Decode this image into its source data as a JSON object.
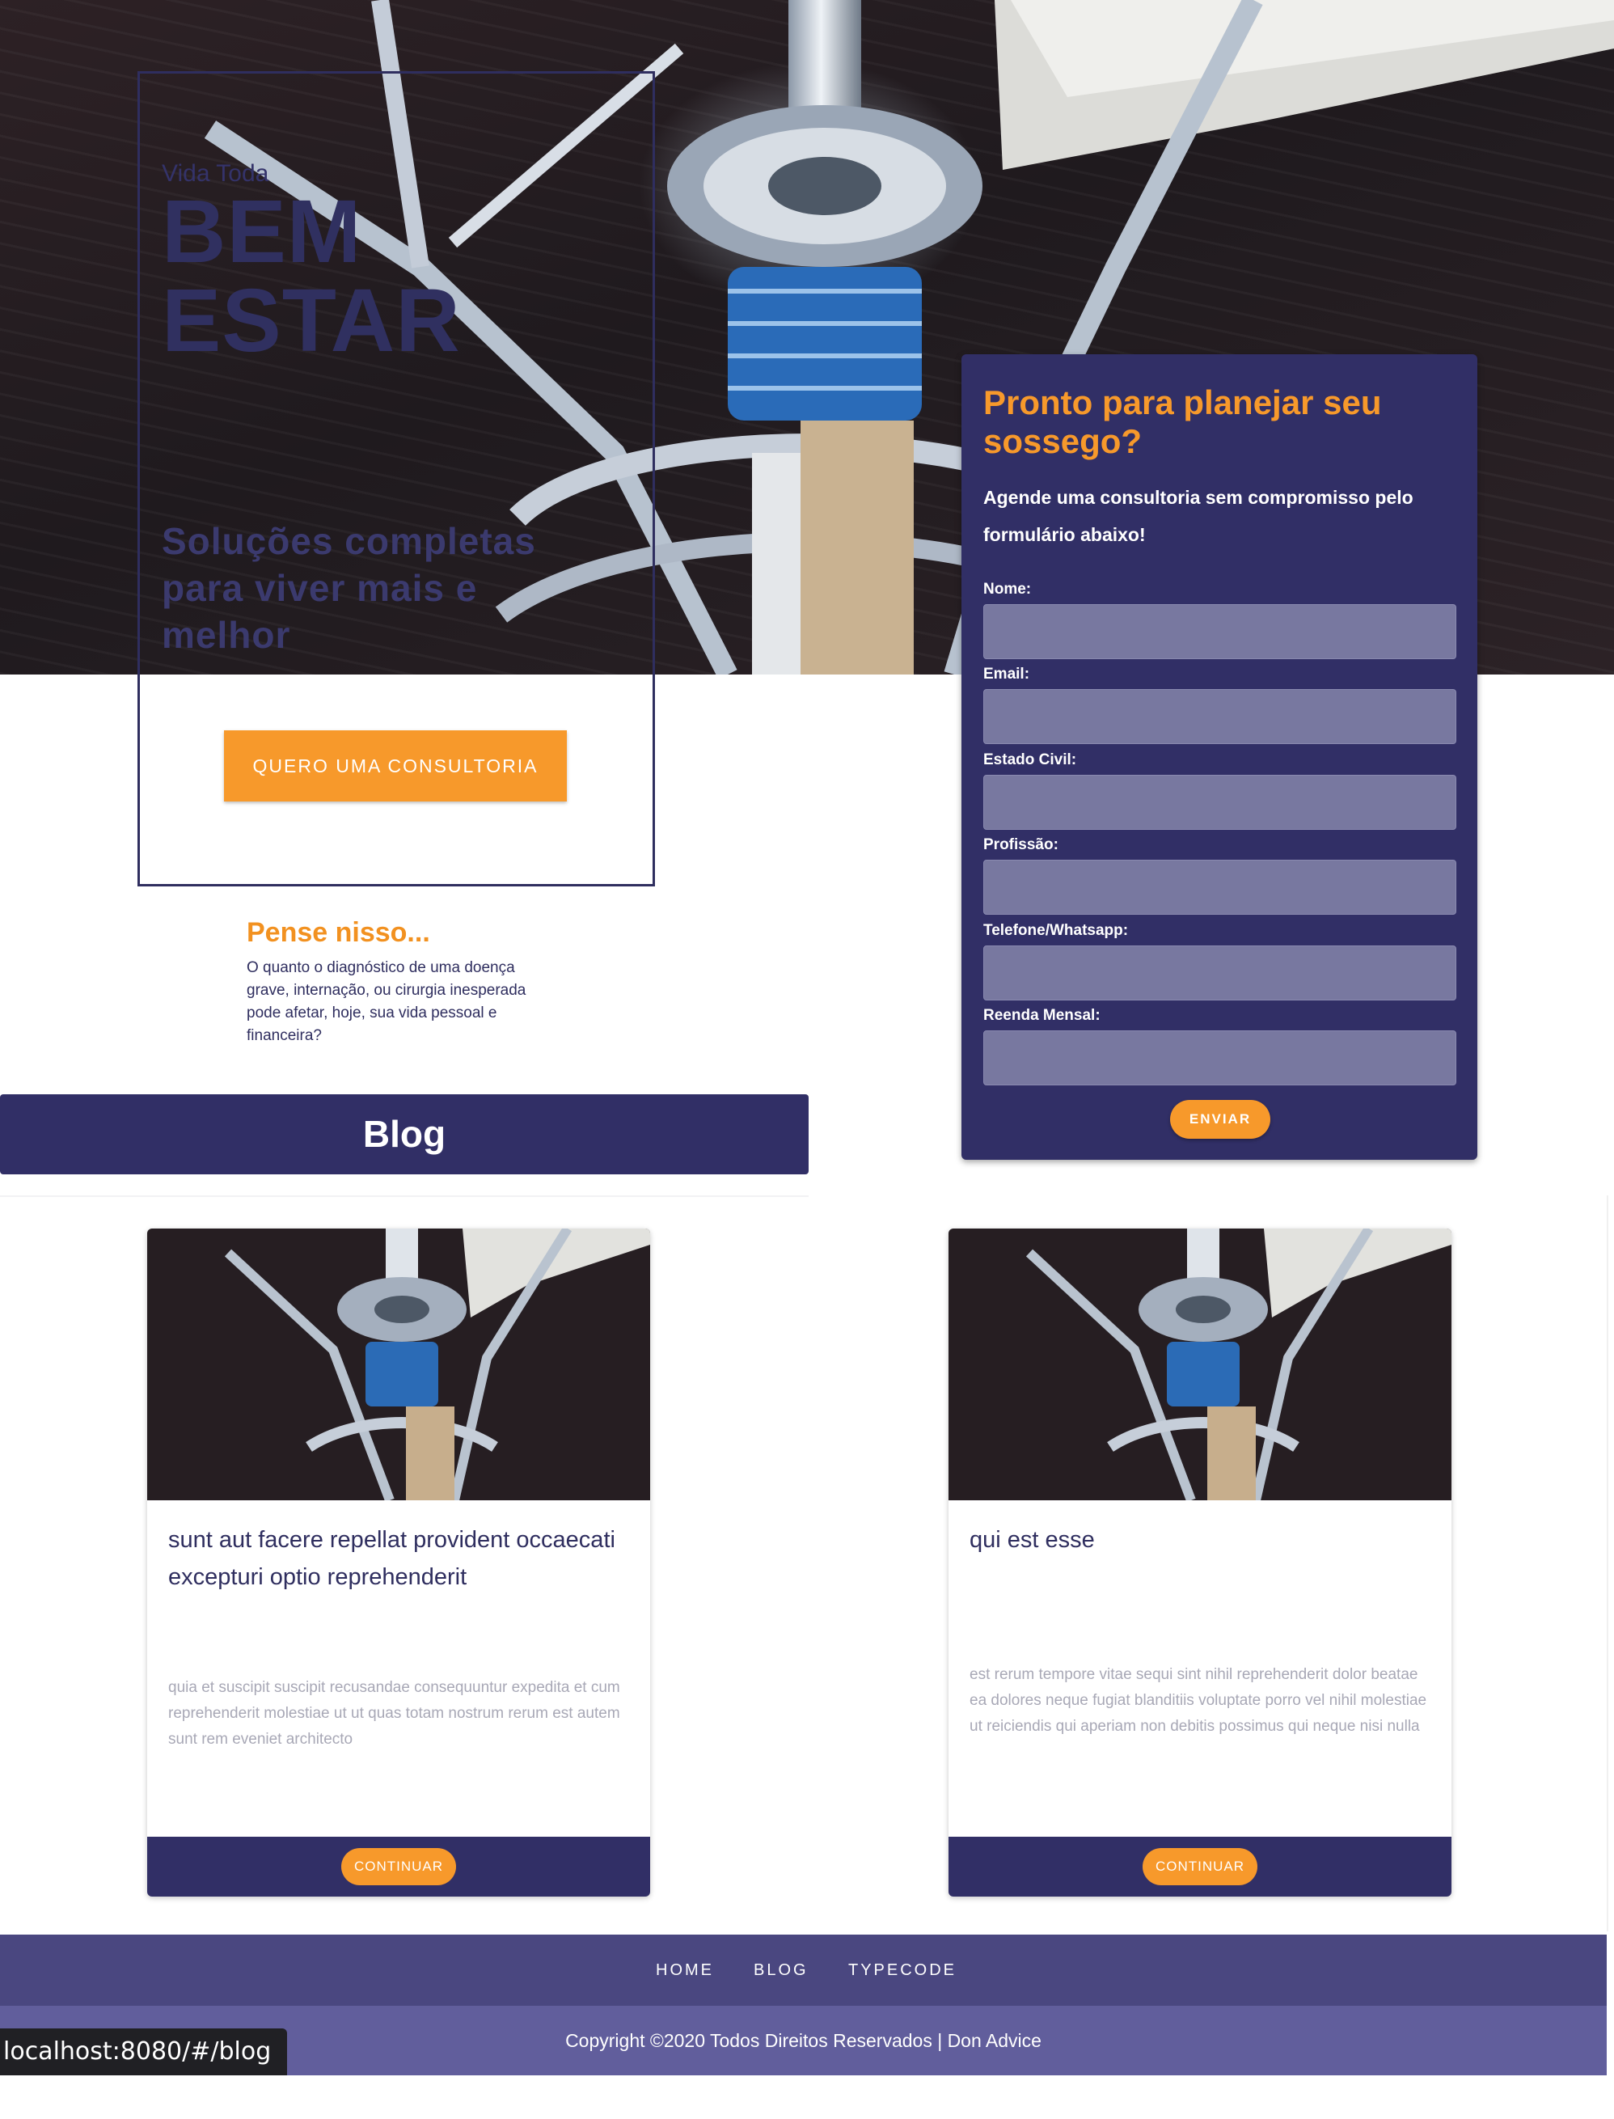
{
  "hero": {
    "eyebrow": "Vida Toda",
    "title_line1": "BEM",
    "title_line2": "ESTAR",
    "subtitle": "Soluções completas para viver mais e melhor",
    "cta_label": "QUERO UMA CONSULTORIA"
  },
  "think": {
    "title": "Pense nisso...",
    "text": "O quanto o diagnóstico de uma doença grave, internação, ou cirurgia inesperada pode afetar, hoje, sua vida pessoal e financeira?"
  },
  "form": {
    "title": "Pronto para planejar seu sossego?",
    "subtitle": "Agende uma consultoria sem compromisso pelo formulário abaixo!",
    "fields": [
      {
        "label": "Nome:",
        "value": ""
      },
      {
        "label": "Email:",
        "value": ""
      },
      {
        "label": "Estado Civil:",
        "value": ""
      },
      {
        "label": "Profissão:",
        "value": ""
      },
      {
        "label": "Telefone/Whatsapp:",
        "value": ""
      },
      {
        "label": "Reenda Mensal:",
        "value": ""
      }
    ],
    "submit_label": "ENVIAR"
  },
  "blog": {
    "heading": "Blog",
    "posts": [
      {
        "title": "sunt aut facere repellat provident occaecati excepturi optio reprehenderit",
        "body": "quia et suscipit suscipit recusandae consequuntur expedita et cum reprehenderit molestiae ut ut quas totam nostrum rerum est autem sunt rem eveniet architecto",
        "button_label": "CONTINUAR"
      },
      {
        "title": "qui est esse",
        "body": "est rerum tempore vitae sequi sint nihil reprehenderit dolor beatae ea dolores neque fugiat blanditiis voluptate porro vel nihil molestiae ut reiciendis qui aperiam non debitis possimus qui neque nisi nulla",
        "button_label": "CONTINUAR"
      }
    ]
  },
  "footer": {
    "nav": [
      "HOME",
      "BLOG",
      "TYPECODE"
    ],
    "copyright": "Copyright ©2020 Todos Direitos Reservados | Don Advice"
  },
  "status_bar": {
    "url": "localhost:8080/#/blog"
  },
  "colors": {
    "brand_navy": "#312f66",
    "accent_orange": "#f7992b",
    "nav_purple": "#4a4780",
    "copyright_purple": "#615e9c",
    "input_fill": "#7878a0"
  },
  "icons": [
    "sailboat-photo"
  ]
}
